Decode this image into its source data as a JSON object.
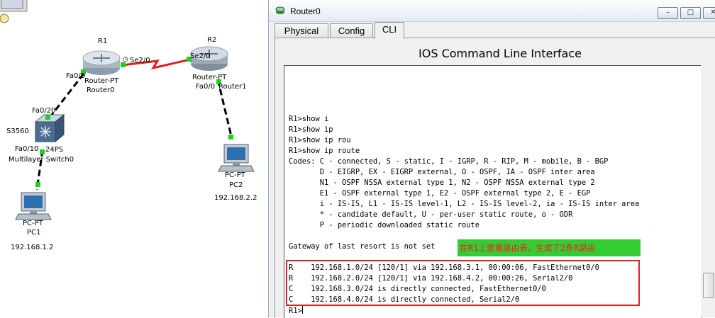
{
  "colors": {
    "link_ethernet": "#000000",
    "link_serial": "#e31b1b",
    "port_dot": "#1cd31c",
    "annotation_bg": "#33cc33",
    "annotation_text": "#ff1a1a",
    "highlight_box": "#e32020"
  },
  "topology": {
    "r1_name": "R1",
    "r1_type": "Router-PT",
    "r1_label": "Router0",
    "r1_port_serial": "Se2/0",
    "r1_port_fa": "Fa0/0",
    "r2_name": "R2",
    "r2_port_serial": "Se2/0",
    "r2_type": "Router-PT",
    "r2_port_fa": "Fa0/0",
    "r2_label": "Router1",
    "switch_port_up": "Fa0/20",
    "switch_name": "S3560",
    "switch_type_suffix": "24PS",
    "switch_port_down": "Fa0/10",
    "switch_label": "Multilayer Switch0",
    "pc1_type": "PC-PT",
    "pc1_name": "PC1",
    "pc1_ip": "192.168.1.2",
    "pc2_type": "PC-PT",
    "pc2_name": "PC2",
    "pc2_ip": "192.168.2.2"
  },
  "window": {
    "title": "Router0",
    "minimize": "–",
    "maximize": "□",
    "close": "✕",
    "tabs": [
      "Physical",
      "Config",
      "CLI"
    ],
    "active_tab": "CLI",
    "heading": "IOS Command Line Interface"
  },
  "cli": {
    "lines": [
      "R1>show i",
      "R1>show ip",
      "R1>show ip rou",
      "R1>show ip route",
      "Codes: C - connected, S - static, I - IGRP, R - RIP, M - mobile, B - BGP",
      "       D - EIGRP, EX - EIGRP external, O - OSPF, IA - OSPF inter area",
      "       N1 - OSPF NSSA external type 1, N2 - OSPF NSSA external type 2",
      "       E1 - OSPF external type 1, E2 - OSPF external type 2, E - EGP",
      "       i - IS-IS, L1 - IS-IS level-1, L2 - IS-IS level-2, ia - IS-IS inter area",
      "       * - candidate default, U - per-user static route, o - ODR",
      "       P - periodic downloaded static route"
    ],
    "gateway": "Gateway of last resort is not set",
    "annotation": "在R1上查看路由表，生成了2条R路由",
    "routes": [
      "R    192.168.1.0/24 [120/1] via 192.168.3.1, 00:00:06, FastEthernet0/0",
      "R    192.168.2.0/24 [120/1] via 192.168.4.2, 00:00:26, Serial2/0",
      "C    192.168.3.0/24 is directly connected, FastEthernet0/0",
      "C    192.168.4.0/24 is directly connected, Serial2/0"
    ],
    "prompt": "R1>"
  }
}
